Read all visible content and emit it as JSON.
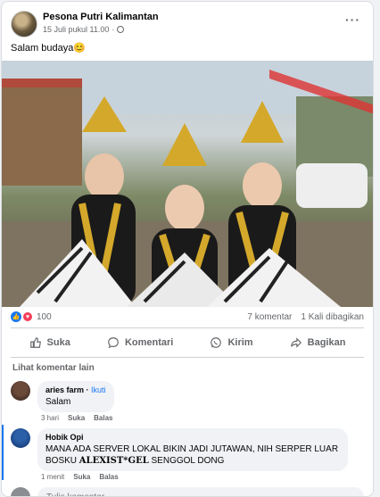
{
  "post": {
    "page_name": "Pesona Putri Kalimantan",
    "date": "15 Juli pukul 11.00",
    "separator": "·",
    "text": "Salam budaya",
    "emoji": "😊",
    "more_icon": "more-horizontal-icon",
    "privacy_icon": "globe-icon"
  },
  "stats": {
    "reaction_count": "100",
    "comments": "7 komentar",
    "shares": "1 Kali dibagikan"
  },
  "actions": [
    {
      "label": "Suka",
      "icon": "like-icon"
    },
    {
      "label": "Komentari",
      "icon": "comment-icon"
    },
    {
      "label": "Kirim",
      "icon": "whatsapp-icon"
    },
    {
      "label": "Bagikan",
      "icon": "share-icon"
    }
  ],
  "more_comments": "Lihat komentar lain",
  "comments": [
    {
      "name": "aries farm",
      "follow": "Ikuti",
      "text": "Salam",
      "time": "3 hari",
      "like": "Suka",
      "reply": "Balas"
    },
    {
      "name": "Hobik Opi",
      "text_prefix": "MANA ADA SERVER LOKAL BIKIN JADI JUTAWAN, NIH SERPER LUAR BOSKU",
      "text_brand": "ALEXIST*GEL",
      "text_suffix": "SENGGOL DONG",
      "time": "1 menit",
      "like": "Suka",
      "reply": "Balas"
    }
  ],
  "write_comment": {
    "placeholder": "Tulis komentar..."
  },
  "colors": {
    "accent": "#1877f2",
    "love": "#f33e58",
    "muted": "#65676b"
  }
}
